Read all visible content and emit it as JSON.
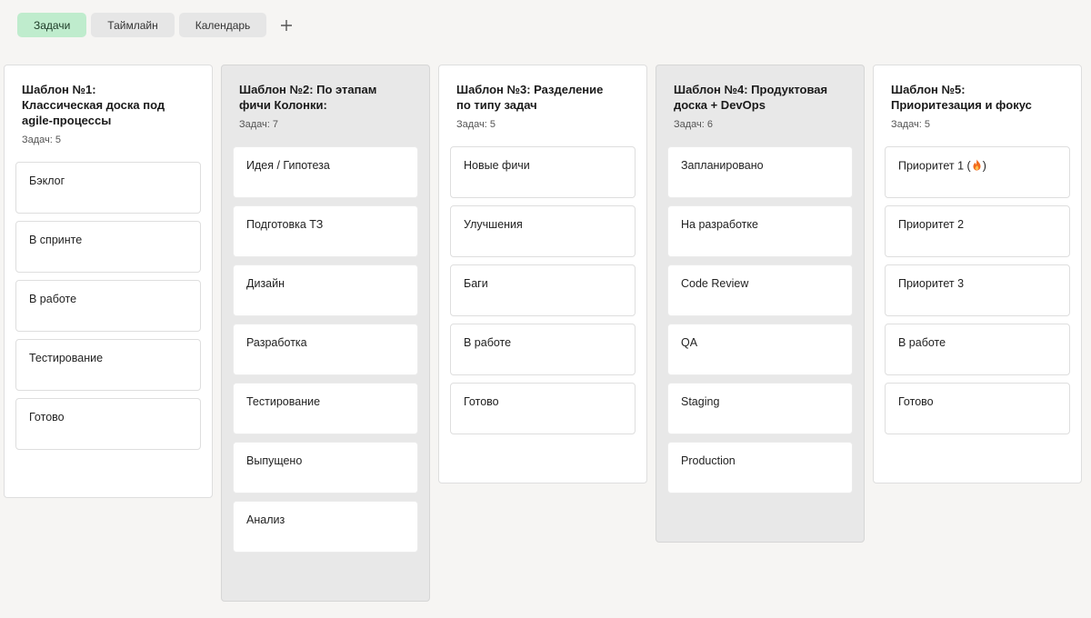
{
  "tabs": [
    {
      "label": "Задачи",
      "active": true
    },
    {
      "label": "Таймлайн",
      "active": false
    },
    {
      "label": "Календарь",
      "active": false
    }
  ],
  "add_tab_icon": "plus-icon",
  "columns": [
    {
      "title_lines": [
        "Шаблон №1:",
        "Классическая доска под",
        "agile-процессы"
      ],
      "count_label": "Задач: 5",
      "cards": [
        "Бэклог",
        "В спринте",
        "В работе",
        "Тестирование",
        "Готово"
      ]
    },
    {
      "title_lines": [
        "Шаблон №2: По этапам",
        "фичи Колонки:"
      ],
      "count_label": "Задач: 7",
      "cards": [
        "Идея / Гипотеза",
        "Подготовка ТЗ",
        "Дизайн",
        "Разработка",
        "Тестирование",
        "Выпущено",
        "Анализ"
      ]
    },
    {
      "title_lines": [
        "Шаблон №3: Разделение",
        "по типу задач"
      ],
      "count_label": "Задач: 5",
      "cards": [
        "Новые фичи",
        "Улучшения",
        "Баги",
        "В работе",
        "Готово"
      ]
    },
    {
      "title_lines": [
        "Шаблон №4: Продуктовая",
        "доска + DevOps"
      ],
      "count_label": "Задач: 6",
      "cards": [
        "Запланировано",
        "На разработке",
        "Code Review",
        "QA",
        "Staging",
        "Production"
      ]
    },
    {
      "title_lines": [
        "Шаблон №5:",
        "Приоритезация и фокус"
      ],
      "count_label": "Задач: 5",
      "cards": [
        "Приоритет 1 (",
        "Приоритет 2",
        "Приоритет 3",
        "В работе",
        "Готово"
      ],
      "first_card_suffix": ")",
      "first_card_icon": "fire-icon",
      "fire_color": "#f26b1d"
    }
  ]
}
